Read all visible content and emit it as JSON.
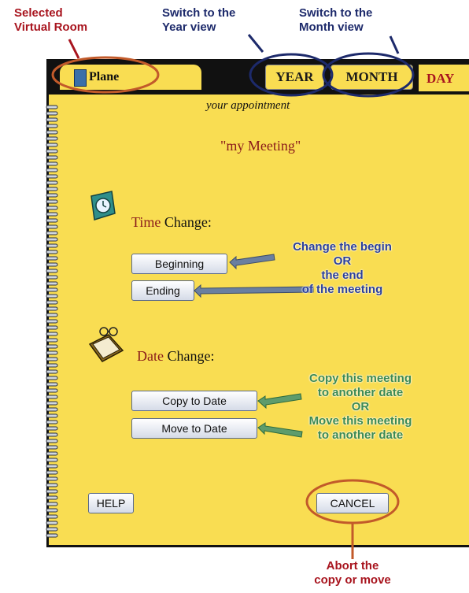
{
  "annotations": {
    "selected_room": [
      "Selected",
      "Virtual Room"
    ],
    "year_view": [
      "Switch to the",
      "Year view"
    ],
    "month_view": [
      "Switch to the",
      "Month view"
    ],
    "change_times": [
      "Change the begin",
      "OR",
      "the end",
      "of the meeting"
    ],
    "copy_move": [
      "Copy this meeting",
      "to another date",
      "OR",
      "Move this meeting",
      "to another date"
    ],
    "abort": [
      "Abort the",
      "copy or move"
    ]
  },
  "header": {
    "room_label": "Plane",
    "year_tab": "YEAR",
    "month_tab": "MONTH",
    "day_tab": "DAY"
  },
  "main": {
    "subtitle": "your appointment",
    "meeting_title": "\"my Meeting\"",
    "time_section": {
      "word": "Time",
      "rest": "Change:"
    },
    "date_section": {
      "word": "Date",
      "rest": "Change:"
    },
    "buttons": {
      "beginning": "Beginning",
      "ending": "Ending",
      "copy_to_date": "Copy to Date",
      "move_to_date": "Move to Date",
      "help": "HELP",
      "cancel": "CANCEL"
    }
  },
  "colors": {
    "page": "#f9dd52",
    "annotation_red": "#a8141e",
    "annotation_navy": "#1d2a6b",
    "annotation_blue": "#2b3f9a",
    "annotation_green": "#3c8a52"
  }
}
